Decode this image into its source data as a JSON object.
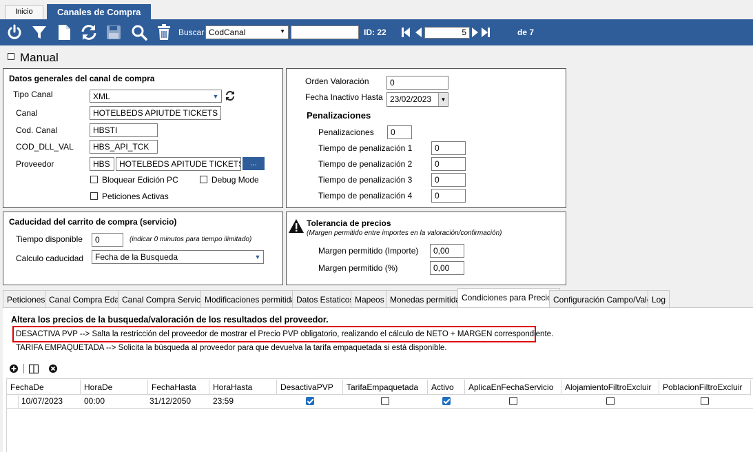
{
  "tabs_top": [
    "Inicio",
    "Canales de Compra"
  ],
  "toolbar": {
    "search_label": "Buscar",
    "search_field": "CodCanal",
    "search_value": "",
    "id_label": "ID: 22",
    "page_value": "5",
    "page_total": "de 7",
    "icons": [
      "power-icon",
      "filter-icon",
      "new-document-icon",
      "refresh-icon",
      "save-icon",
      "search-icon",
      "trash-icon"
    ]
  },
  "manual_label": "Manual",
  "general": {
    "title": "Datos generales del canal de compra",
    "tipo_canal_label": "Tipo Canal",
    "tipo_canal_value": "XML",
    "canal_label": "Canal",
    "canal_value": "HOTELBEDS APIUTDE TICKETS X",
    "cod_canal_label": "Cod. Canal",
    "cod_canal_value": "HBSTI",
    "cod_dll_label": "COD_DLL_VAL",
    "cod_dll_value": "HBS_API_TCK",
    "proveedor_label": "Proveedor",
    "proveedor_code": "HBS",
    "proveedor_name": "HOTELBEDS APITUDE TICKETS",
    "browse_label": "...",
    "bloquear_label": "Bloquear Edición PC",
    "debug_label": "Debug Mode",
    "peticiones_label": "Peticiones Activas"
  },
  "right_top": {
    "orden_label": "Orden Valoración",
    "orden_value": "0",
    "fecha_label": "Fecha Inactivo Hasta",
    "fecha_value": "23/02/2023",
    "pen_title": "Penalizaciones",
    "pen_label": "Penalizaciones",
    "pen_value": "0",
    "t1_label": "Tiempo de penalización 1",
    "t1_value": "0",
    "t2_label": "Tiempo de penalización 2",
    "t2_value": "0",
    "t3_label": "Tiempo de penalización 3",
    "t3_value": "0",
    "t4_label": "Tiempo de penalización 4",
    "t4_value": "0"
  },
  "caducidad": {
    "title": "Caducidad del carrito de compra (servicio)",
    "tiempo_label": "Tiempo disponible",
    "tiempo_value": "0",
    "tiempo_hint": "(indicar 0 minutos para tiempo ilimitado)",
    "calculo_label": "Calculo caducidad",
    "calculo_value": "Fecha de la Busqueda"
  },
  "tolerancia": {
    "title": "Tolerancia de precios",
    "subtitle": "(Margen permitido entre importes en la valoración/confirmación)",
    "importe_label": "Margen permitido (Importe)",
    "importe_value": "0,00",
    "pct_label": "Margen permitido (%)",
    "pct_value": "0,00"
  },
  "tabs_bottom": [
    "Peticiones",
    "Canal Compra Edad",
    "Canal Compra Servicio",
    "Modificaciones permitidas",
    "Datos Estaticos",
    "Mapeos",
    "Monedas permitidas",
    "Condiciones para Precios",
    "Configuración Campo/Valor",
    "Log"
  ],
  "panel": {
    "heading": "Altera los precios de la busqueda/valoración de los resultados del proveedor.",
    "line1": "DESACTIVA PVP --> Salta la restricción del proveedor de mostrar el Precio PVP obligatorio, realizando el cálculo de NETO + MARGEN correspondiente.",
    "line2": "TARIFA EMPAQUETADA --> Solicita la búsqueda al proveedor para que devuelva la tarifa empaquetada si está disponible.",
    "highlight_color": "#e00000"
  },
  "grid": {
    "headers": [
      "FechaDe",
      "HoraDe",
      "FechaHasta",
      "HoraHasta",
      "DesactivaPVP",
      "TarifaEmpaquetada",
      "Activo",
      "AplicaEnFechaServicio",
      "AlojamientoFiltroExcluir",
      "PoblacionFiltroExcluir"
    ],
    "row": {
      "fecha_de": "10/07/2023",
      "hora_de": "00:00",
      "fecha_hasta": "31/12/2050",
      "hora_hasta": "23:59",
      "desactiva_pvp": true,
      "tarifa_empaquetada": false,
      "activo": true,
      "aplica_fecha_servicio": false,
      "alojamiento_excluir": false,
      "poblacion_excluir": false
    }
  },
  "colors": {
    "toolbar": "#2e5d9a",
    "accent_check": "#1f6fc5"
  }
}
